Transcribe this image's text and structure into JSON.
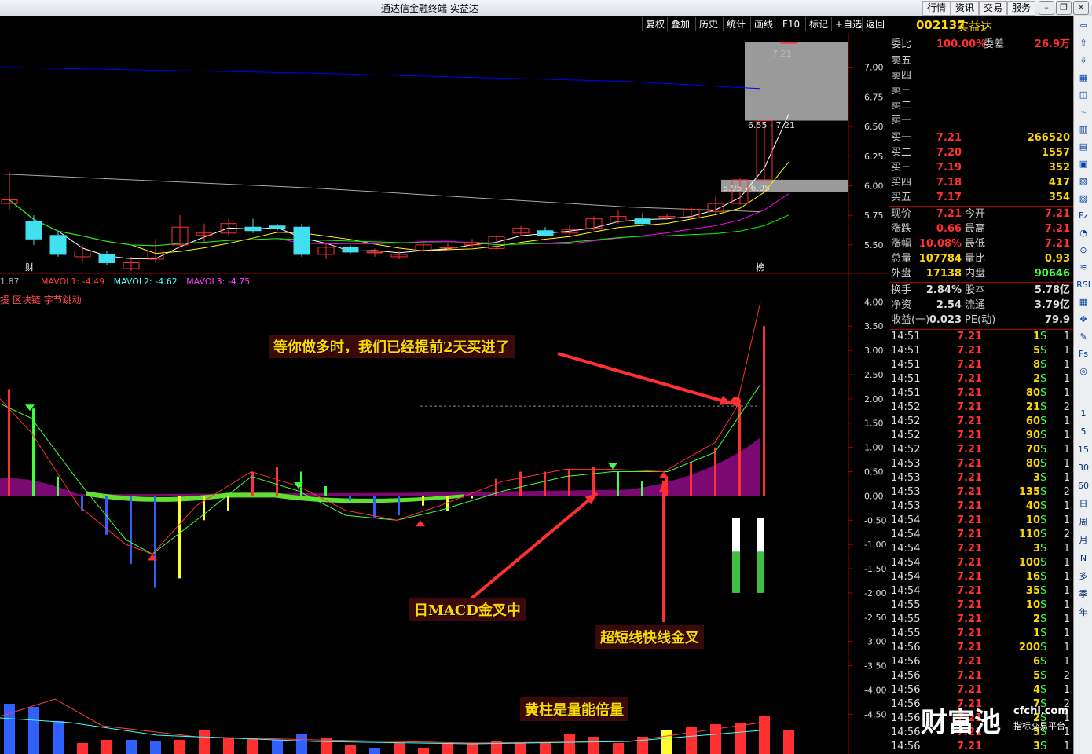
{
  "window": {
    "title": "通达信金融终端  实益达"
  },
  "top_menu": [
    "行情",
    "资讯",
    "交易",
    "服务"
  ],
  "toolbar": [
    "复权",
    "叠加",
    "历史",
    "统计",
    "画线",
    "F10",
    "标记",
    "+自选",
    "返回"
  ],
  "stock": {
    "code": "002137",
    "name": "实益达"
  },
  "weibi": {
    "label": "委比",
    "value": "100.00%",
    "label2": "委差",
    "value2": "26.9万"
  },
  "asks": [
    {
      "label": "卖五",
      "price": "",
      "vol": ""
    },
    {
      "label": "卖四",
      "price": "",
      "vol": ""
    },
    {
      "label": "卖三",
      "price": "",
      "vol": ""
    },
    {
      "label": "卖二",
      "price": "",
      "vol": ""
    },
    {
      "label": "卖一",
      "price": "",
      "vol": ""
    }
  ],
  "bids": [
    {
      "label": "买一",
      "price": "7.21",
      "vol": "266520"
    },
    {
      "label": "买二",
      "price": "7.20",
      "vol": "1557"
    },
    {
      "label": "买三",
      "price": "7.19",
      "vol": "352"
    },
    {
      "label": "买四",
      "price": "7.18",
      "vol": "417"
    },
    {
      "label": "买五",
      "price": "7.17",
      "vol": "354"
    }
  ],
  "quote": [
    {
      "l1": "现价",
      "v1": "7.21",
      "l2": "今开",
      "v2": "7.21"
    },
    {
      "l1": "涨跌",
      "v1": "0.66",
      "l2": "最高",
      "v2": "7.21"
    },
    {
      "l1": "涨幅",
      "v1": "10.08%",
      "l2": "最低",
      "v2": "7.21"
    },
    {
      "l1": "总量",
      "v1": "107784",
      "l2": "量比",
      "v2": "0.93"
    },
    {
      "l1": "外盘",
      "v1": "17138",
      "l2": "内盘",
      "v2": "90646"
    }
  ],
  "fund": [
    {
      "l1": "换手",
      "v1": "2.84%",
      "l2": "股本",
      "v2": "5.78亿"
    },
    {
      "l1": "净资",
      "v1": "2.54",
      "l2": "流通",
      "v2": "3.79亿"
    },
    {
      "l1": "收益(一)",
      "v1": "0.023",
      "l2": "PE(动)",
      "v2": "79.9"
    }
  ],
  "ticks": [
    {
      "t": "14:51",
      "p": "7.21",
      "v": "1",
      "s": "S",
      "n": "1"
    },
    {
      "t": "14:51",
      "p": "7.21",
      "v": "5",
      "s": "S",
      "n": "1"
    },
    {
      "t": "14:51",
      "p": "7.21",
      "v": "8",
      "s": "S",
      "n": "1"
    },
    {
      "t": "14:51",
      "p": "7.21",
      "v": "2",
      "s": "S",
      "n": "1"
    },
    {
      "t": "14:51",
      "p": "7.21",
      "v": "80",
      "s": "S",
      "n": "1"
    },
    {
      "t": "14:52",
      "p": "7.21",
      "v": "21",
      "s": "S",
      "n": "2"
    },
    {
      "t": "14:52",
      "p": "7.21",
      "v": "60",
      "s": "S",
      "n": "1"
    },
    {
      "t": "14:52",
      "p": "7.21",
      "v": "90",
      "s": "S",
      "n": "1"
    },
    {
      "t": "14:52",
      "p": "7.21",
      "v": "70",
      "s": "S",
      "n": "1"
    },
    {
      "t": "14:53",
      "p": "7.21",
      "v": "80",
      "s": "S",
      "n": "1"
    },
    {
      "t": "14:53",
      "p": "7.21",
      "v": "3",
      "s": "S",
      "n": "1"
    },
    {
      "t": "14:53",
      "p": "7.21",
      "v": "135",
      "s": "S",
      "n": "2"
    },
    {
      "t": "14:53",
      "p": "7.21",
      "v": "40",
      "s": "S",
      "n": "1"
    },
    {
      "t": "14:54",
      "p": "7.21",
      "v": "10",
      "s": "S",
      "n": "1"
    },
    {
      "t": "14:54",
      "p": "7.21",
      "v": "110",
      "s": "S",
      "n": "2"
    },
    {
      "t": "14:54",
      "p": "7.21",
      "v": "3",
      "s": "S",
      "n": "1"
    },
    {
      "t": "14:54",
      "p": "7.21",
      "v": "100",
      "s": "S",
      "n": "1"
    },
    {
      "t": "14:54",
      "p": "7.21",
      "v": "16",
      "s": "S",
      "n": "1"
    },
    {
      "t": "14:54",
      "p": "7.21",
      "v": "35",
      "s": "S",
      "n": "1"
    },
    {
      "t": "14:55",
      "p": "7.21",
      "v": "10",
      "s": "S",
      "n": "1"
    },
    {
      "t": "14:55",
      "p": "7.21",
      "v": "2",
      "s": "S",
      "n": "1"
    },
    {
      "t": "14:55",
      "p": "7.21",
      "v": "1",
      "s": "S",
      "n": "1"
    },
    {
      "t": "14:56",
      "p": "7.21",
      "v": "200",
      "s": "S",
      "n": "1"
    },
    {
      "t": "14:56",
      "p": "7.21",
      "v": "6",
      "s": "S",
      "n": "1"
    },
    {
      "t": "14:56",
      "p": "7.21",
      "v": "5",
      "s": "S",
      "n": "2"
    },
    {
      "t": "14:56",
      "p": "7.21",
      "v": "4",
      "s": "S",
      "n": "1"
    },
    {
      "t": "14:56",
      "p": "7.21",
      "v": "7",
      "s": "S",
      "n": "2"
    },
    {
      "t": "14:56",
      "p": "7.21",
      "v": "2",
      "s": "S",
      "n": "1"
    },
    {
      "t": "14:56",
      "p": "7.21",
      "v": "5",
      "s": "S",
      "n": "1"
    },
    {
      "t": "14:56",
      "p": "7.21",
      "v": "3",
      "s": "S",
      "n": "1"
    }
  ],
  "side_buttons": [
    "1",
    "5",
    "15",
    "30",
    "60",
    "日",
    "周",
    "月",
    "N",
    "多",
    "季",
    "年"
  ],
  "chart_data": {
    "type": "candlestick",
    "price_axis": {
      "ticks": [
        "7.00",
        "6.75",
        "6.50",
        "6.25",
        "6.00",
        "5.75",
        "5.50"
      ],
      "range": [
        5.3,
        7.25
      ]
    },
    "gap_labels": [
      "7.21",
      "6.55 - 7.21",
      "5.95 - 6.05"
    ],
    "badges": [
      "财",
      "榜"
    ],
    "indicator_header": {
      "prefix": "1.87",
      "mavol1": "MAVOL1: -4.49",
      "mavol2": "MAVOL2: -4.62",
      "mavol3": "MAVOL3: -4.75"
    },
    "concept": "援 区块链 字节跳动",
    "indicator_axis": {
      "ticks": [
        "4.00",
        "3.50",
        "3.00",
        "2.50",
        "2.00",
        "1.50",
        "1.00",
        "0.50",
        "0.00",
        "-0.50",
        "-1.00",
        "-1.50",
        "-2.00",
        "-2.50",
        "-3.00",
        "-3.50",
        "-4.00",
        "-4.50"
      ],
      "range": [
        -4.9,
        4.2
      ]
    },
    "candles": [
      {
        "o": 5.85,
        "c": 5.88,
        "h": 6.12,
        "l": 5.8
      },
      {
        "o": 5.7,
        "c": 5.55,
        "h": 5.75,
        "l": 5.5
      },
      {
        "o": 5.58,
        "c": 5.42,
        "h": 5.62,
        "l": 5.4
      },
      {
        "o": 5.4,
        "c": 5.45,
        "h": 5.5,
        "l": 5.35
      },
      {
        "o": 5.42,
        "c": 5.35,
        "h": 5.45,
        "l": 5.33
      },
      {
        "o": 5.3,
        "c": 5.35,
        "h": 5.4,
        "l": 5.28
      },
      {
        "o": 5.38,
        "c": 5.45,
        "h": 5.55,
        "l": 5.35
      },
      {
        "o": 5.5,
        "c": 5.65,
        "h": 5.75,
        "l": 5.48
      },
      {
        "o": 5.58,
        "c": 5.6,
        "h": 5.68,
        "l": 5.52
      },
      {
        "o": 5.6,
        "c": 5.68,
        "h": 5.72,
        "l": 5.58
      },
      {
        "o": 5.65,
        "c": 5.62,
        "h": 5.72,
        "l": 5.6
      },
      {
        "o": 5.66,
        "c": 5.64,
        "h": 5.68,
        "l": 5.62
      },
      {
        "o": 5.65,
        "c": 5.42,
        "h": 5.68,
        "l": 5.4
      },
      {
        "o": 5.42,
        "c": 5.48,
        "h": 5.52,
        "l": 5.38
      },
      {
        "o": 5.48,
        "c": 5.44,
        "h": 5.5,
        "l": 5.42
      },
      {
        "o": 5.44,
        "c": 5.44,
        "h": 5.47,
        "l": 5.4
      },
      {
        "o": 5.4,
        "c": 5.42,
        "h": 5.45,
        "l": 5.38
      },
      {
        "o": 5.45,
        "c": 5.5,
        "h": 5.53,
        "l": 5.44
      },
      {
        "o": 5.48,
        "c": 5.48,
        "h": 5.52,
        "l": 5.46
      },
      {
        "o": 5.5,
        "c": 5.52,
        "h": 5.55,
        "l": 5.48
      },
      {
        "o": 5.47,
        "c": 5.57,
        "h": 5.58,
        "l": 5.46
      },
      {
        "o": 5.6,
        "c": 5.64,
        "h": 5.66,
        "l": 5.58
      },
      {
        "o": 5.62,
        "c": 5.58,
        "h": 5.65,
        "l": 5.57
      },
      {
        "o": 5.6,
        "c": 5.63,
        "h": 5.67,
        "l": 5.58
      },
      {
        "o": 5.64,
        "c": 5.72,
        "h": 5.74,
        "l": 5.62
      },
      {
        "o": 5.7,
        "c": 5.74,
        "h": 5.79,
        "l": 5.68
      },
      {
        "o": 5.72,
        "c": 5.68,
        "h": 5.77,
        "l": 5.66
      },
      {
        "o": 5.73,
        "c": 5.74,
        "h": 5.76,
        "l": 5.71
      },
      {
        "o": 5.73,
        "c": 5.8,
        "h": 5.82,
        "l": 5.72
      },
      {
        "o": 5.78,
        "c": 5.85,
        "h": 5.92,
        "l": 5.76
      },
      {
        "o": 5.85,
        "c": 6.05,
        "h": 6.06,
        "l": 5.84
      },
      {
        "o": 6.05,
        "c": 6.55,
        "h": 6.55,
        "l": 6.05
      },
      {
        "o": 7.21,
        "c": 7.21,
        "h": 7.21,
        "l": 7.21
      }
    ],
    "ma_lines": [
      "#ffffff",
      "#ffff00",
      "#ff00ff",
      "#00ff00",
      "#0000ff",
      "#aaaaaa"
    ],
    "annotations": [
      "等你做多时，我们已经提前2天买进了",
      "日MACD金叉中",
      "超短线快线金叉",
      "黄柱是量能倍量"
    ]
  }
}
